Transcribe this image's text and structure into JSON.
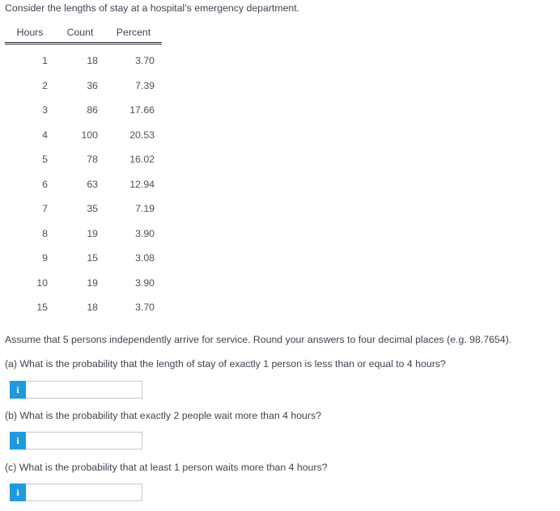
{
  "accent_color": "#1f9bdd",
  "text_color": "#3d4450",
  "intro": "Consider the lengths of stay at a hospital’s emergency department.",
  "table": {
    "columns": [
      "Hours",
      "Count",
      "Percent"
    ],
    "rows": [
      {
        "hours": "1",
        "count": "18",
        "percent": "3.70"
      },
      {
        "hours": "2",
        "count": "36",
        "percent": "7.39"
      },
      {
        "hours": "3",
        "count": "86",
        "percent": "17.66"
      },
      {
        "hours": "4",
        "count": "100",
        "percent": "20.53"
      },
      {
        "hours": "5",
        "count": "78",
        "percent": "16.02"
      },
      {
        "hours": "6",
        "count": "63",
        "percent": "12.94"
      },
      {
        "hours": "7",
        "count": "35",
        "percent": "7.19"
      },
      {
        "hours": "8",
        "count": "19",
        "percent": "3.90"
      },
      {
        "hours": "9",
        "count": "15",
        "percent": "3.08"
      },
      {
        "hours": "10",
        "count": "19",
        "percent": "3.90"
      },
      {
        "hours": "15",
        "count": "18",
        "percent": "3.70"
      }
    ]
  },
  "instructions": "Assume that 5 persons independently arrive for service. Round your answers to four decimal places (e.g. 98.7654).",
  "questions": [
    {
      "label": "(a) What is the probability that the length of stay of exactly 1 person is less than or equal to 4 hours?",
      "badge": "i",
      "value": "",
      "placeholder": ""
    },
    {
      "label": "(b) What is the probability that exactly 2 people wait more than 4 hours?",
      "badge": "i",
      "value": "",
      "placeholder": ""
    },
    {
      "label": "(c) What is the probability that at least 1 person waits more than 4 hours?",
      "badge": "i",
      "value": "",
      "placeholder": ""
    }
  ]
}
